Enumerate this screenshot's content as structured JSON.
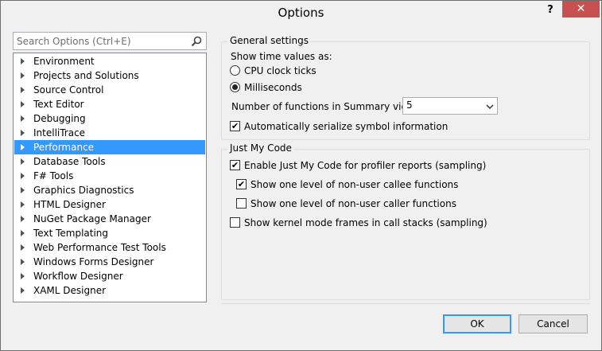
{
  "window": {
    "title": "Options",
    "help_label": "?",
    "close_label": "✕"
  },
  "search": {
    "placeholder": "Search Options (Ctrl+E)",
    "value": ""
  },
  "tree": {
    "selected_index": 6,
    "items": [
      "Environment",
      "Projects and Solutions",
      "Source Control",
      "Text Editor",
      "Debugging",
      "IntelliTrace",
      "Performance",
      "Database Tools",
      "F# Tools",
      "Graphics Diagnostics",
      "HTML Designer",
      "NuGet Package Manager",
      "Text Templating",
      "Web Performance Test Tools",
      "Windows Forms Designer",
      "Workflow Designer",
      "XAML Designer"
    ]
  },
  "general": {
    "title": "General settings",
    "time_label": "Show time values as:",
    "radio_cpu": "CPU clock ticks",
    "radio_ms": "Milliseconds",
    "selected_time": "Milliseconds",
    "functions_label": "Number of functions in Summary view:",
    "functions_value": "5",
    "serialize_label": "Automatically serialize symbol information",
    "serialize_checked": true
  },
  "jmc": {
    "title": "Just My Code",
    "enable_label": "Enable Just My Code for profiler reports (sampling)",
    "enable_checked": true,
    "callee_label": "Show one level of non-user callee functions",
    "callee_checked": true,
    "caller_label": "Show one level of non-user caller functions",
    "caller_checked": false,
    "kernel_label": "Show kernel mode frames in call stacks (sampling)",
    "kernel_checked": false
  },
  "buttons": {
    "ok": "OK",
    "cancel": "Cancel"
  },
  "colors": {
    "selection": "#3399ff",
    "close": "#c75050"
  },
  "icons": {
    "search": "search-icon",
    "close": "close-icon",
    "dropdown": "chevron-down-icon"
  }
}
